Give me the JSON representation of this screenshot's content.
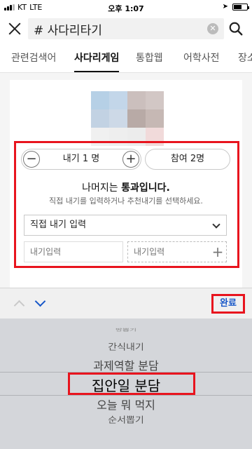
{
  "status_bar": {
    "carrier": "KT",
    "network": "LTE",
    "time": "오후 1:07"
  },
  "search": {
    "query": "# 사다리타기"
  },
  "tabs": [
    {
      "label": "관련검색어"
    },
    {
      "label": "사다리게임"
    },
    {
      "label": "통합웹"
    },
    {
      "label": "어학사전"
    },
    {
      "label": "장소"
    }
  ],
  "active_tab": "사다리게임",
  "game": {
    "player_count": "내기 1 명",
    "join_label": "참여 2명",
    "result_prefix": "나머지는 ",
    "result_bold": "통과입니다.",
    "result_sub": "직접 내기를 입력하거나 추천내기를 선택하세요.",
    "select_value": "직접 내기 입력",
    "bet_placeholder_1": "내기입력",
    "bet_placeholder_2": "내기입력"
  },
  "toolbar": {
    "done_label": "완료"
  },
  "picker": {
    "items": [
      "방뽑기",
      "간식내기",
      "과제역할 분담",
      "집안일 분담",
      "오늘 뭐 먹지",
      "순서뽑기"
    ],
    "selected": "집안일 분담"
  },
  "colors": {
    "highlight": "#e8141e",
    "link_blue": "#1656c8",
    "picker_bg": "#d4d6da"
  },
  "thumbnail_colors": [
    "#b6d0e6",
    "#c3d6e9",
    "#cbbfbd",
    "#d2c7c5",
    "#c2d2e3",
    "#cdd9e7",
    "#b8aaa6",
    "#c6b8b4",
    "#f0f0f0",
    "#eeeeee",
    "#ececec",
    "#f1dada"
  ]
}
